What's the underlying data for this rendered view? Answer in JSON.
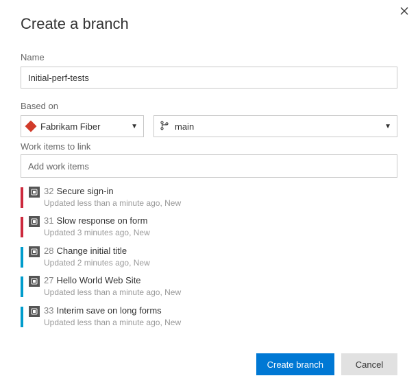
{
  "dialog": {
    "title": "Create a branch",
    "name_label": "Name",
    "name_value": "Initial-perf-tests",
    "based_on_label": "Based on",
    "repo_name": "Fabrikam Fiber",
    "source_branch": "main",
    "work_items_label": "Work items to link",
    "work_items_placeholder": "Add work items",
    "create_label": "Create branch",
    "cancel_label": "Cancel"
  },
  "colors": {
    "bug": "#cc293d",
    "task": "#009ccc"
  },
  "work_items": [
    {
      "id": "32",
      "title": "Secure sign-in",
      "subtitle": "Updated less than a minute ago, New",
      "colorKey": "bug"
    },
    {
      "id": "31",
      "title": "Slow response on form",
      "subtitle": "Updated 3 minutes ago, New",
      "colorKey": "bug"
    },
    {
      "id": "28",
      "title": "Change initial title",
      "subtitle": "Updated 2 minutes ago, New",
      "colorKey": "task"
    },
    {
      "id": "27",
      "title": "Hello World Web Site",
      "subtitle": "Updated less than a minute ago, New",
      "colorKey": "task"
    },
    {
      "id": "33",
      "title": "Interim save on long forms",
      "subtitle": "Updated less than a minute ago, New",
      "colorKey": "task"
    }
  ]
}
